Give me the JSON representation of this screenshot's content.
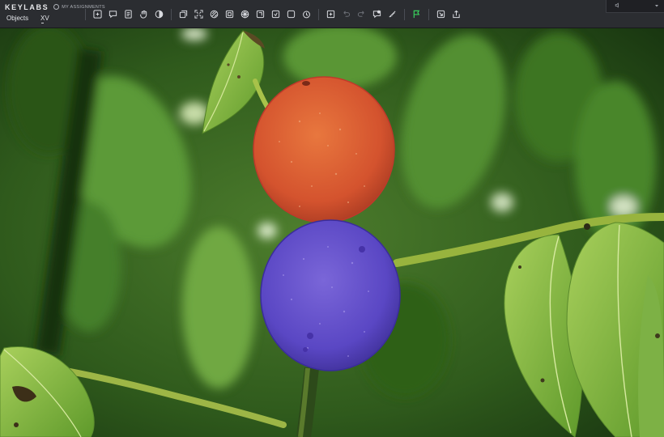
{
  "app": {
    "logo_text": "KEYLABS",
    "assignments_label": "MY ASSIGNMENTS"
  },
  "tabs": {
    "objects": "Objects",
    "xv": "XV"
  },
  "tools": [
    {
      "name": "create-object-icon"
    },
    {
      "name": "comment-icon"
    },
    {
      "name": "document-icon"
    },
    {
      "name": "pan-hand-icon"
    },
    {
      "name": "contrast-icon"
    },
    {
      "name": "copy-icon"
    },
    {
      "name": "expand-icon"
    },
    {
      "name": "brush-icon"
    },
    {
      "name": "grid-icon"
    },
    {
      "name": "pattern-icon"
    },
    {
      "name": "layers-icon"
    },
    {
      "name": "frame-icon"
    },
    {
      "name": "timer-icon"
    },
    {
      "name": "crosshair-icon"
    },
    {
      "name": "undo-icon"
    },
    {
      "name": "redo-icon"
    },
    {
      "name": "ai-assist-icon"
    },
    {
      "name": "ruler-icon"
    },
    {
      "name": "flag-icon"
    },
    {
      "name": "export-icon"
    },
    {
      "name": "share-icon"
    }
  ],
  "topright": {
    "left_icon": "volume-icon",
    "right_icon": "chevron-down-icon"
  },
  "annotations": [
    {
      "label": "fruit-top",
      "color": "#e04a36"
    },
    {
      "label": "fruit-bottom",
      "color": "#5a45c8"
    }
  ],
  "colors": {
    "toolbar_bg": "#2b2d31",
    "flag_accent": "#39d05c"
  }
}
